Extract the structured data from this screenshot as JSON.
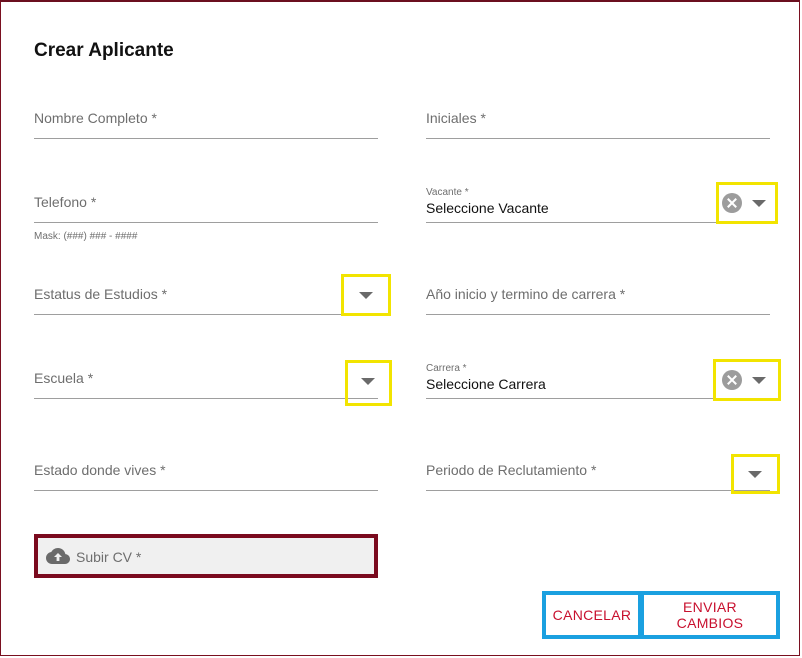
{
  "dialog": {
    "title": "Crear Aplicante"
  },
  "fields": {
    "nombre": {
      "label": "Nombre Completo *"
    },
    "iniciales": {
      "label": "Iniciales *"
    },
    "telefono": {
      "label": "Telefono *",
      "hint": "Mask: (###) ### - ####"
    },
    "vacante": {
      "label": "Vacante *",
      "value": "Seleccione Vacante"
    },
    "estatus": {
      "label": "Estatus de Estudios *"
    },
    "anio": {
      "label": "Año inicio y termino de carrera *"
    },
    "escuela": {
      "label": "Escuela *"
    },
    "carrera": {
      "label": "Carrera *",
      "value": "Seleccione Carrera"
    },
    "estado": {
      "label": "Estado donde vives *"
    },
    "periodo": {
      "label": "Periodo de Reclutamiento *"
    }
  },
  "upload": {
    "label": "Subir CV *",
    "icon": "cloud-upload-icon"
  },
  "actions": {
    "cancel_label": "CANCELAR",
    "submit_label": "ENVIAR CAMBIOS"
  },
  "colors": {
    "accent": "#c8102e",
    "highlight_yellow": "#f2e400",
    "highlight_blue": "#1aa0e0",
    "highlight_dark_red": "#7a0a1e"
  }
}
